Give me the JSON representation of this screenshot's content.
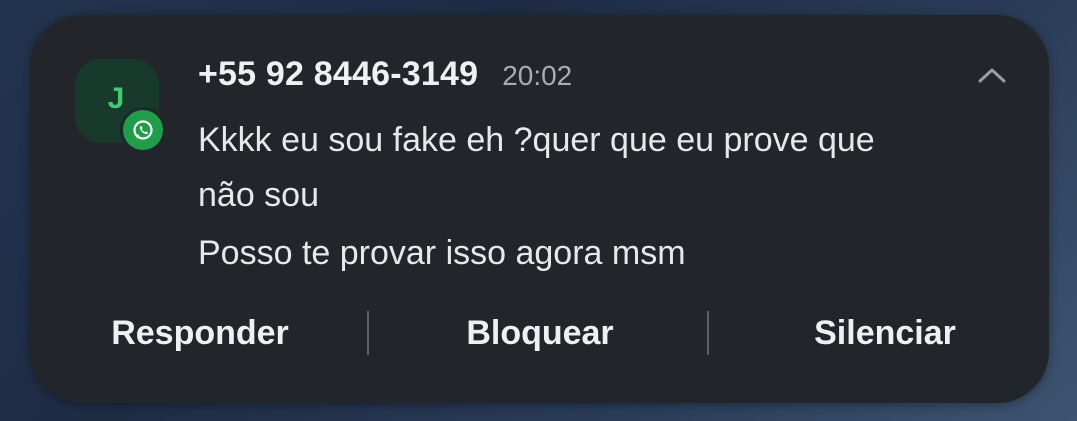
{
  "notification": {
    "avatar_letter": "J",
    "app_icon": "whatsapp-icon",
    "sender": "+55 92 8446-3149",
    "time": "20:02",
    "collapse_icon": "chevron-up-icon",
    "messages": [
      "Kkkk eu sou fake eh ?quer que eu prove que não sou",
      "Posso te provar isso agora msm"
    ],
    "actions": {
      "reply": "Responder",
      "block": "Bloquear",
      "mute": "Silenciar"
    }
  },
  "colors": {
    "card_bg": "#222529",
    "avatar_bg": "#183a2d",
    "avatar_letter": "#3ecb6a",
    "whatsapp_green": "#1e9e48",
    "text_primary": "#eef0f2",
    "text_secondary": "#a9adb3"
  }
}
